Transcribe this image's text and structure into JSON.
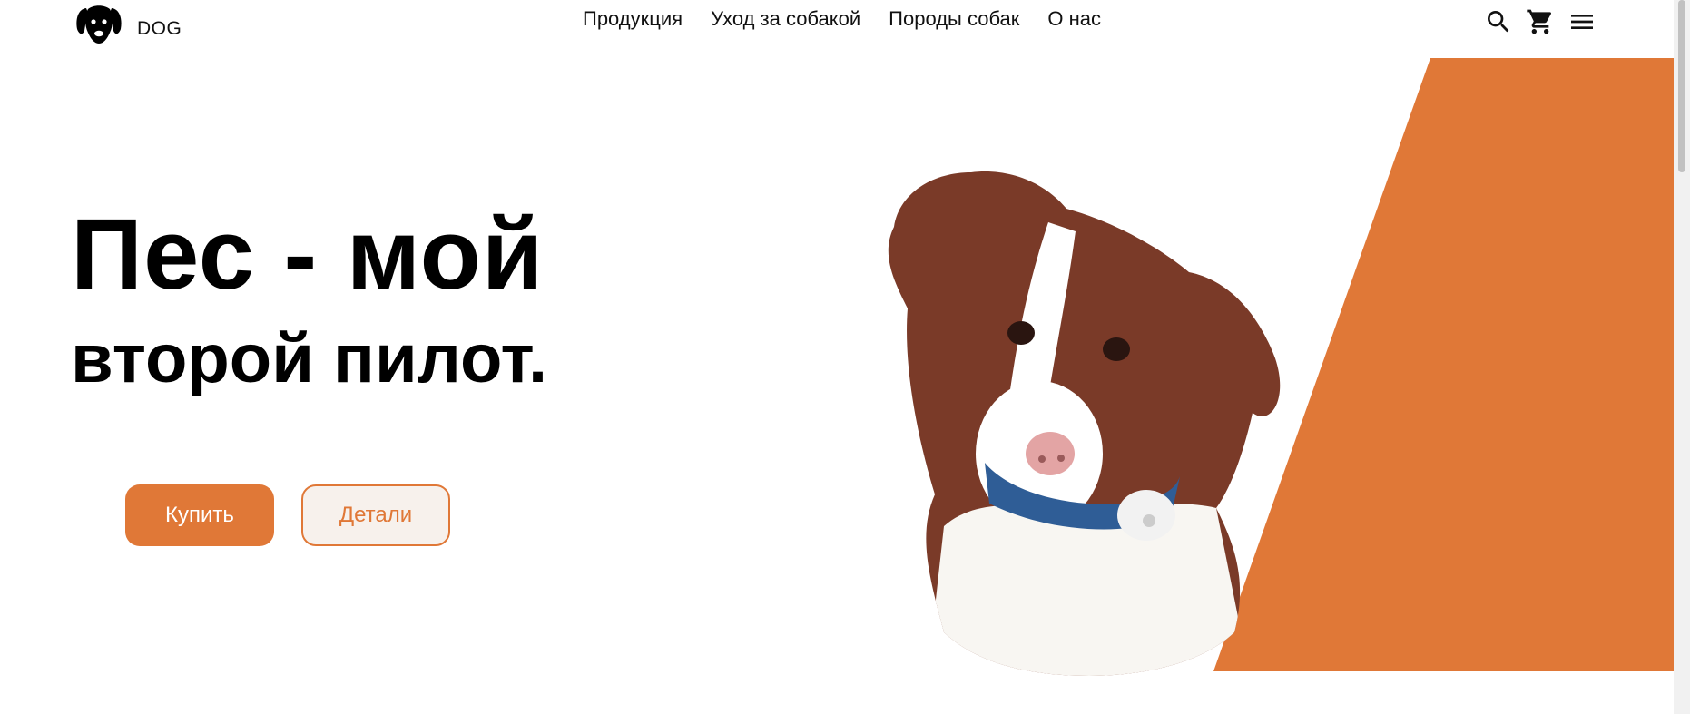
{
  "brand": {
    "name": "DOG",
    "logo_icon": "dog-head-icon"
  },
  "nav": {
    "items": [
      {
        "label": "Продукция"
      },
      {
        "label": "Уход за собакой"
      },
      {
        "label": "Породы собак"
      },
      {
        "label": "О нас"
      }
    ]
  },
  "actions": {
    "icons": [
      "search-icon",
      "cart-icon",
      "menu-icon"
    ]
  },
  "hero": {
    "title_line1": "Пес - мой",
    "title_line2": "второй пилот.",
    "buy_label": "Купить",
    "details_label": "Детали",
    "image": "puppy-with-gps-collar"
  },
  "colors": {
    "accent": "#e07837",
    "text": "#111111",
    "background": "#ffffff"
  }
}
